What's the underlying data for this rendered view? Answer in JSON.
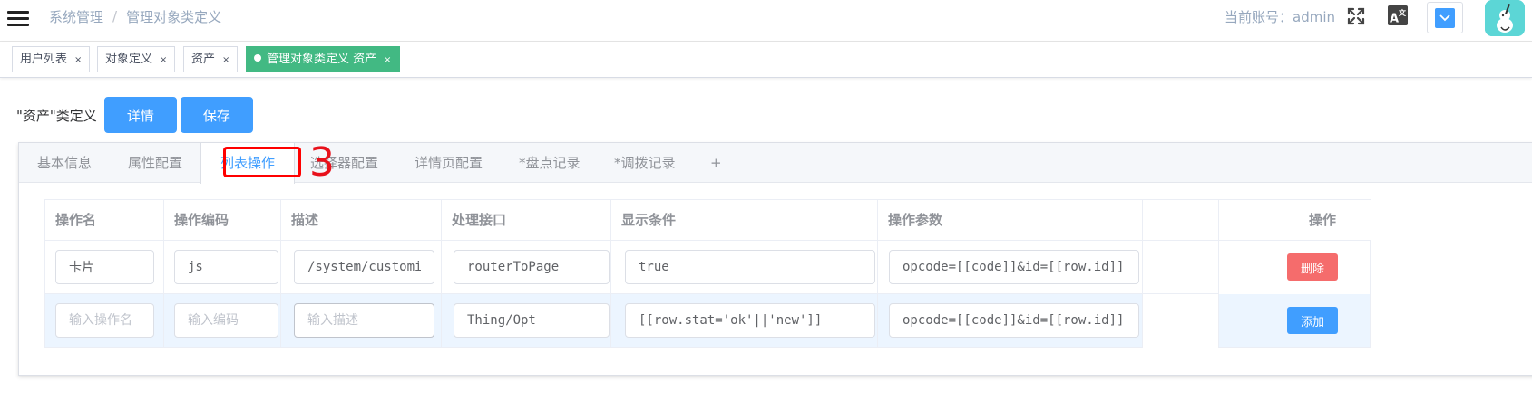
{
  "header": {
    "breadcrumb": [
      "系统管理",
      "管理对象类定义"
    ],
    "breadcrumb_sep": "/",
    "account": "当前账号：admin"
  },
  "tags": [
    {
      "label": "用户列表",
      "close": "×"
    },
    {
      "label": "对象定义",
      "close": "×"
    },
    {
      "label": "资产",
      "close": "×"
    },
    {
      "label": "管理对象类定义 资产",
      "close": "×",
      "active": true
    }
  ],
  "page": {
    "title": "\"资产\"类定义",
    "detail_btn": "详情",
    "save_btn": "保存"
  },
  "tabs": [
    "基本信息",
    "属性配置",
    "列表操作",
    "选择器配置",
    "详情页配置",
    "*盘点记录",
    "*调拨记录",
    "+"
  ],
  "active_tab": "列表操作",
  "annotation": "3",
  "table": {
    "columns": [
      "操作名",
      "操作编码",
      "描述",
      "处理接口",
      "显示条件",
      "操作参数",
      "",
      "操作"
    ],
    "rows": [
      {
        "name": "卡片",
        "code": "js",
        "desc": "/system/customi",
        "api": "routerToPage",
        "condition": "true",
        "params": "opcode=[[code]]&id=[[row.id]]",
        "action": "删除"
      },
      {
        "name": "",
        "code": "",
        "desc": "",
        "api": "Thing/Opt",
        "condition": "[[row.stat='ok'||'new']]",
        "params": "opcode=[[code]]&id=[[row.id]]",
        "action": "添加"
      }
    ],
    "placeholders": {
      "name": "输入操作名",
      "code": "输入编码",
      "desc": "输入描述"
    }
  },
  "colors": {
    "primary": "#409eff",
    "active_tag": "#42b983",
    "danger": "#f56c6c",
    "annotation": "#e8111b"
  }
}
